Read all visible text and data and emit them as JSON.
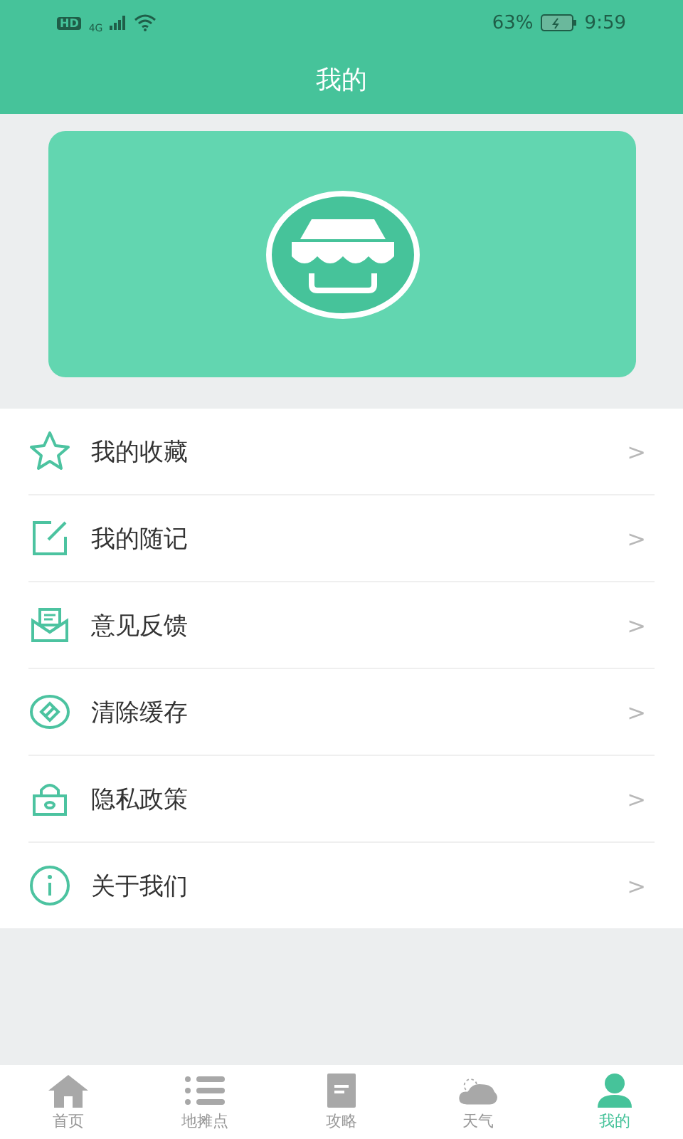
{
  "status_bar": {
    "network_badge": "HD",
    "network_type": "4G",
    "battery": "63%",
    "time": "9:59"
  },
  "header": {
    "title": "我的"
  },
  "menu": [
    {
      "label": "我的收藏",
      "chevron": ">"
    },
    {
      "label": "我的随记",
      "chevron": ">"
    },
    {
      "label": "意见反馈",
      "chevron": ">"
    },
    {
      "label": "清除缓存",
      "chevron": ">"
    },
    {
      "label": "隐私政策",
      "chevron": ">"
    },
    {
      "label": "关于我们",
      "chevron": ">"
    }
  ],
  "tabs": [
    {
      "label": "首页",
      "selected": false
    },
    {
      "label": "地摊点",
      "selected": false
    },
    {
      "label": "攻略",
      "selected": false
    },
    {
      "label": "天气",
      "selected": false
    },
    {
      "label": "我的",
      "selected": true
    }
  ]
}
